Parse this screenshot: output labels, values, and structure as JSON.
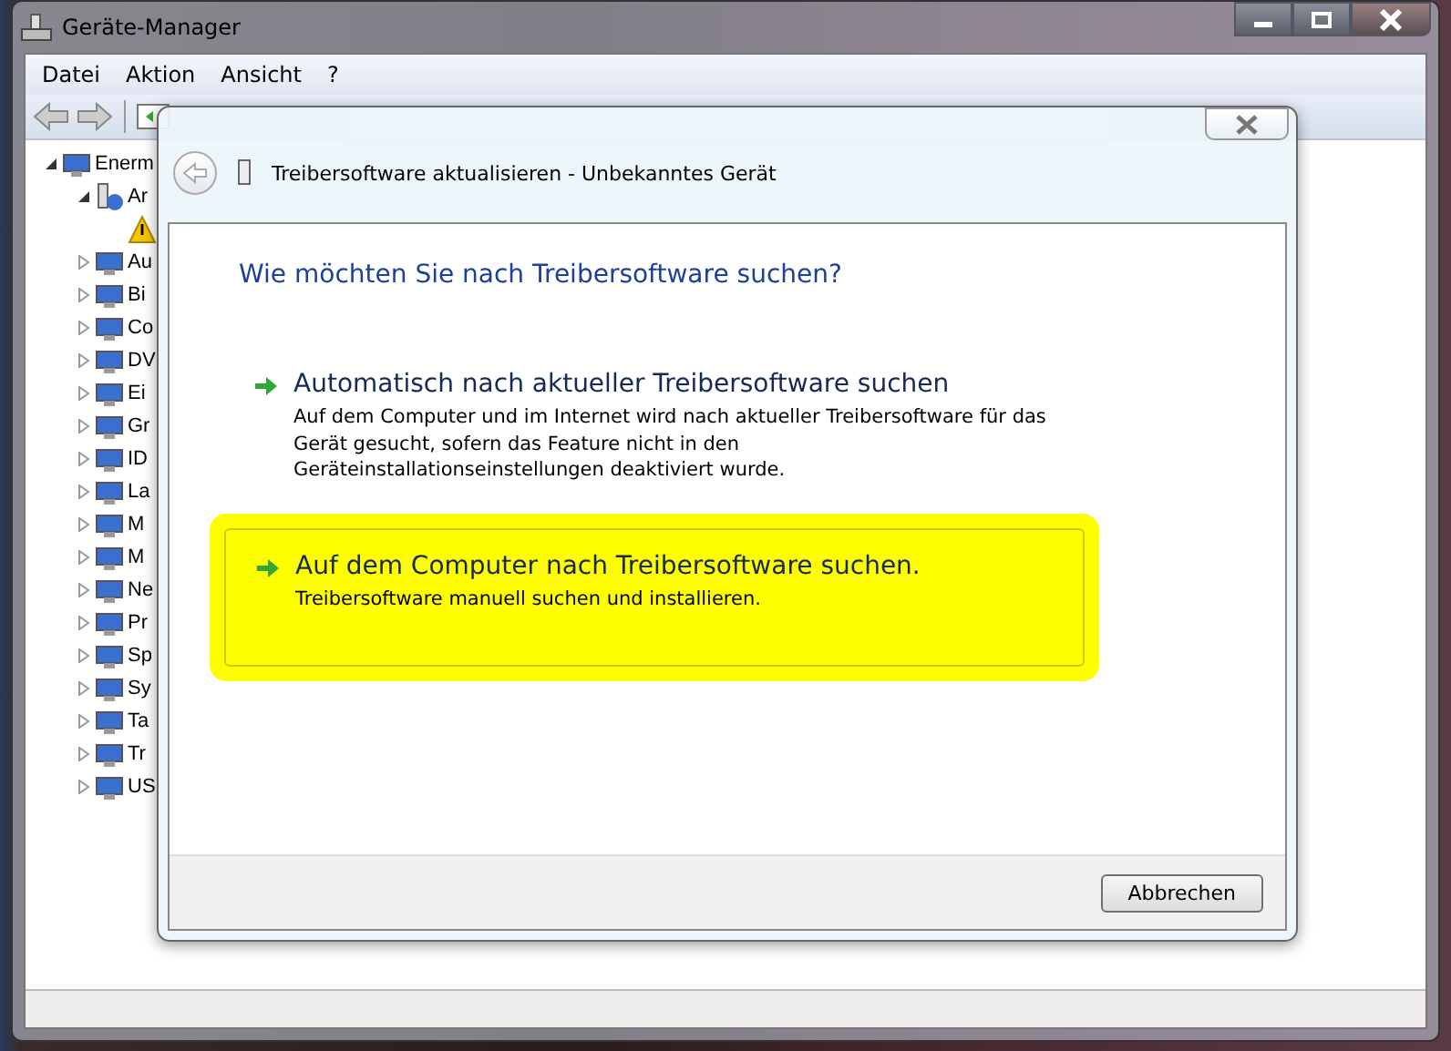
{
  "window": {
    "title": "Geräte-Manager"
  },
  "menu": [
    "Datei",
    "Aktion",
    "Ansicht",
    "?"
  ],
  "tree": [
    {
      "label": "Enerm",
      "expanded": true,
      "children": [
        {
          "label": "Ar",
          "kind": "unknown",
          "expanded": true,
          "children": [
            {
              "kind": "warning"
            }
          ]
        },
        {
          "label": "Au",
          "expanded": false
        },
        {
          "label": "Bi",
          "expanded": false
        },
        {
          "label": "Co",
          "expanded": false
        },
        {
          "label": "DV",
          "expanded": false
        },
        {
          "label": "Ei",
          "expanded": false
        },
        {
          "label": "Gr",
          "expanded": false
        },
        {
          "label": "ID",
          "expanded": false
        },
        {
          "label": "La",
          "expanded": false
        },
        {
          "label": "M",
          "expanded": false
        },
        {
          "label": "M",
          "expanded": false
        },
        {
          "label": "Ne",
          "expanded": false
        },
        {
          "label": "Pr",
          "expanded": false
        },
        {
          "label": "Sp",
          "expanded": false
        },
        {
          "label": "Sy",
          "expanded": false
        },
        {
          "label": "Ta",
          "expanded": false
        },
        {
          "label": "Tr",
          "expanded": false
        },
        {
          "label": "US",
          "expanded": false
        }
      ]
    }
  ],
  "dialog": {
    "title": "Treibersoftware aktualisieren - Unbekanntes Gerät",
    "heading": "Wie möchten Sie nach Treibersoftware suchen?",
    "options": [
      {
        "title": "Automatisch nach aktueller Treibersoftware suchen",
        "description": "Auf dem Computer und im Internet wird nach aktueller Treibersoftware für das Gerät gesucht, sofern das Feature nicht in den Geräteinstallationseinstellungen deaktiviert wurde.",
        "highlighted": false
      },
      {
        "title": "Auf dem Computer nach Treibersoftware suchen.",
        "description": "Treibersoftware manuell suchen und installieren.",
        "highlighted": true
      }
    ],
    "cancel": "Abbrechen"
  }
}
